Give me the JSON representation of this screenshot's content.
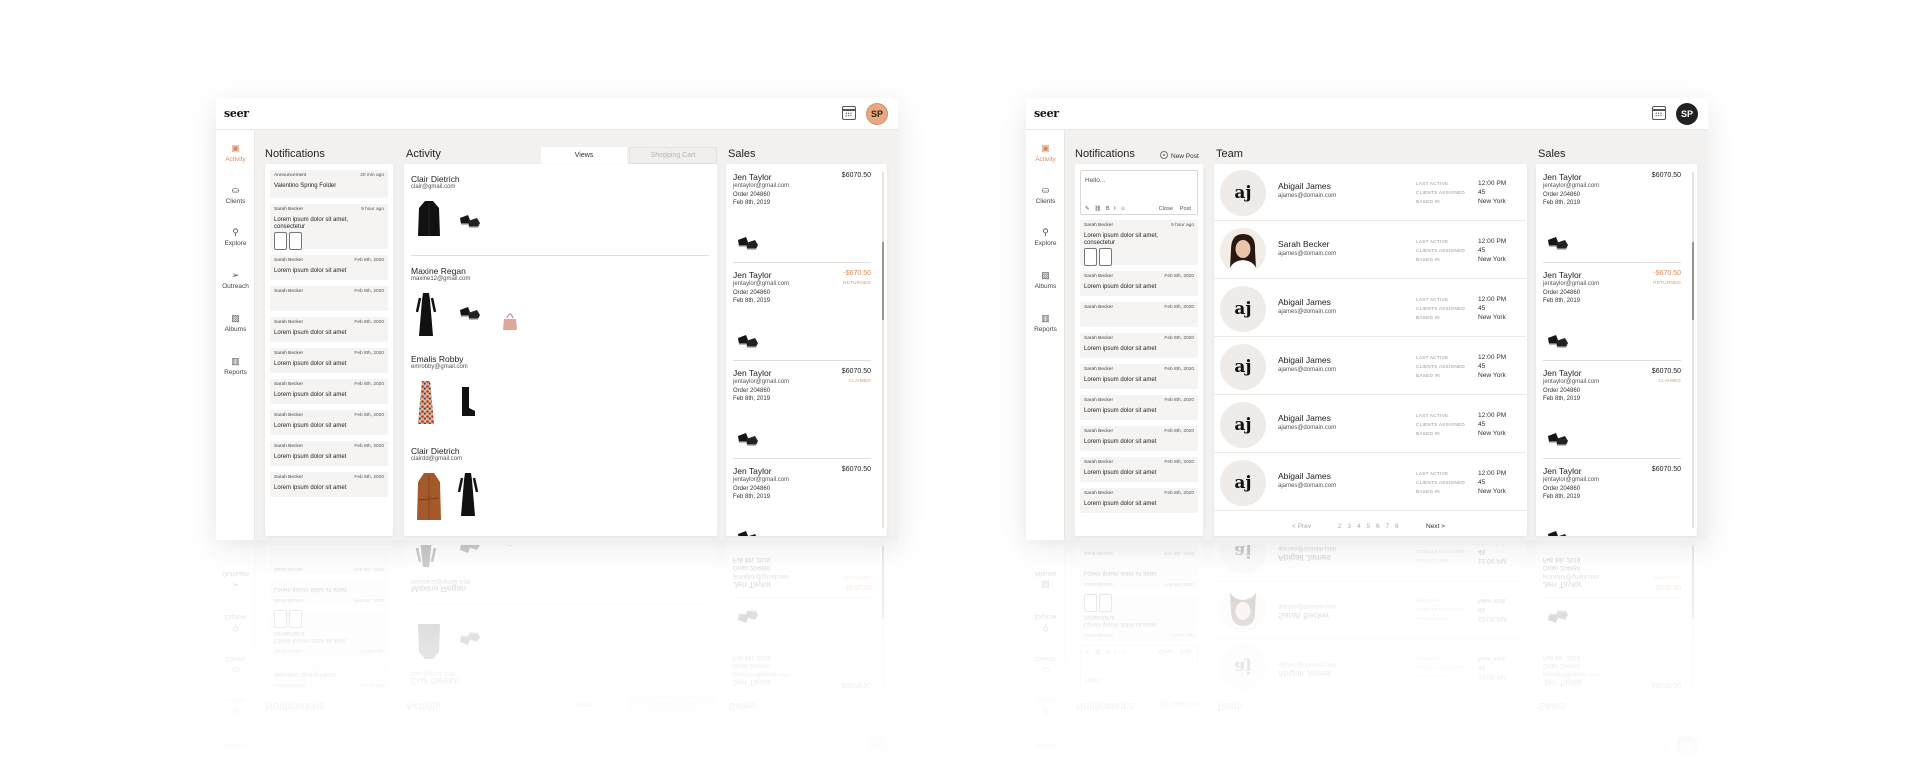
{
  "app": {
    "logo": "seer"
  },
  "nav": [
    {
      "label": "Activity",
      "icon": "activity-icon",
      "glyph": "▣",
      "active": true
    },
    {
      "label": "Clients",
      "icon": "clients-icon",
      "glyph": "⛀",
      "active": false
    },
    {
      "label": "Explore",
      "icon": "explore-icon",
      "glyph": "⚲",
      "active": false
    },
    {
      "label": "Outreach",
      "icon": "outreach-icon",
      "glyph": "➢",
      "active": false
    },
    {
      "label": "Albums",
      "icon": "albums-icon",
      "glyph": "▨",
      "active": false
    },
    {
      "label": "Reports",
      "icon": "reports-icon",
      "glyph": "▥",
      "active": false
    }
  ],
  "nav_right": [
    {
      "label": "Activity",
      "icon": "activity-icon",
      "glyph": "▣",
      "active": true
    },
    {
      "label": "Clients",
      "icon": "clients-icon",
      "glyph": "⛀",
      "active": false
    },
    {
      "label": "Explore",
      "icon": "explore-icon",
      "glyph": "⚲",
      "active": false
    },
    {
      "label": "Albums",
      "icon": "albums-icon",
      "glyph": "▨",
      "active": false
    },
    {
      "label": "Reports",
      "icon": "reports-icon",
      "glyph": "▥",
      "active": false
    }
  ],
  "left": {
    "avatar": "SP",
    "notifications_title": "Notifications",
    "activity_title": "Activity",
    "sales_title": "Sales",
    "tabs": [
      {
        "label": "Views",
        "active": true
      },
      {
        "label": "Shopping Cart",
        "active": false
      }
    ],
    "notifications": [
      {
        "who": "Announcement",
        "when": "20 min ago",
        "msg": "Valentino Spring Folder"
      },
      {
        "who": "Sarah Becker",
        "when": "9 hour ago",
        "msg": "Lorem ipsum dolor sit amet, consectetur",
        "thumbs": [
          "pic1",
          "pic2"
        ]
      },
      {
        "who": "Sarah Becker",
        "when": "Feb 8th, 2020",
        "msg": "Lorem ipsum dolor sit amet"
      },
      {
        "who": "Sarah Becker",
        "when": "Feb 8th, 2020",
        "msg": ""
      },
      {
        "who": "Sarah Becker",
        "when": "Feb 8th, 2020",
        "msg": "Lorem ipsum dolor sit amet"
      },
      {
        "who": "Sarah Becker",
        "when": "Feb 8th, 2020",
        "msg": "Lorem ipsum dolor sit amet"
      },
      {
        "who": "Sarah Becker",
        "when": "Feb 8th, 2020",
        "msg": "Lorem ipsum dolor sit amet"
      },
      {
        "who": "Sarah Becker",
        "when": "Feb 8th, 2020",
        "msg": "Lorem ipsum dolor sit amet"
      },
      {
        "who": "Sarah Becker",
        "when": "Feb 8th, 2020",
        "msg": "Lorem ipsum dolor sit amet"
      },
      {
        "who": "Sarah Becker",
        "when": "Feb 8th, 2020",
        "msg": "Lorem ipsum dolor sit amet"
      }
    ],
    "activity": [
      {
        "name": "Clair Dietrich",
        "email": "clair@gmail.com",
        "items": [
          "black-coat",
          "black-shoes"
        ]
      },
      {
        "name": "Maxine Regan",
        "email": "maxine12@gmail.com",
        "items": [
          "black-dress",
          "black-shoes",
          "pink-bag"
        ]
      },
      {
        "name": "Emalis Robby",
        "email": "emrobby@gmail.com",
        "items": [
          "floral-dress",
          "black-boot"
        ]
      },
      {
        "name": "Clair Dietrich",
        "email": "clairdd@gmail.com",
        "items": [
          "brown-coat",
          "black-dress"
        ]
      }
    ],
    "sales": [
      {
        "name": "Jen Taylor",
        "email": "jentaylor@gmail.com",
        "order": "Order 204860",
        "date": "Feb 8th, 2019",
        "amount": "$6070.50",
        "status": ""
      },
      {
        "name": "Jen Taylor",
        "email": "jentaylor@gmail.com",
        "order": "Order 204860",
        "date": "Feb 8th, 2019",
        "amount": "-$670.50",
        "status": "RETURNED"
      },
      {
        "name": "Jen Taylor",
        "email": "jentaylor@gmail.com",
        "order": "Order 204860",
        "date": "Feb 8th, 2019",
        "amount": "$6070.50",
        "status": "CLAIMED"
      },
      {
        "name": "Jen Taylor",
        "email": "jentaylor@gmail.com",
        "order": "Order 204860",
        "date": "Feb 8th, 2019",
        "amount": "$6070.50",
        "status": ""
      }
    ]
  },
  "right": {
    "avatar": "SP",
    "notifications_title": "Notifications",
    "new_post": "New Post",
    "team_title": "Team",
    "sales_title": "Sales",
    "compose": {
      "placeholder": "Hello...",
      "tools": "✎ ⛓ B I ☺",
      "close": "Close",
      "post": "Post"
    },
    "notifications": [
      {
        "who": "Sarah Becker",
        "when": "9 hour ago",
        "msg": "Lorem ipsum dolor sit amet, consectetur",
        "thumbs": [
          "pic1",
          "pic2"
        ]
      },
      {
        "who": "Sarah Becker",
        "when": "Feb 8th, 2020",
        "msg": "Lorem ipsum dolor sit amet"
      },
      {
        "who": "Sarah Becker",
        "when": "Feb 8th, 2020",
        "msg": ""
      },
      {
        "who": "Sarah Becker",
        "when": "Feb 8th, 2020",
        "msg": "Lorem ipsum dolor sit amet"
      },
      {
        "who": "Sarah Becker",
        "when": "Feb 8th, 2020",
        "msg": "Lorem ipsum dolor sit amet"
      },
      {
        "who": "Sarah Becker",
        "when": "Feb 8th, 2020",
        "msg": "Lorem ipsum dolor sit amet"
      },
      {
        "who": "Sarah Becker",
        "when": "Feb 8th, 2020",
        "msg": "Lorem ipsum dolor sit amet"
      },
      {
        "who": "Sarah Becker",
        "when": "Feb 8th, 2020",
        "msg": "Lorem ipsum dolor sit amet"
      },
      {
        "who": "Sarah Becker",
        "when": "Feb 8th, 2020",
        "msg": "Lorem ipsum dolor sit amet"
      }
    ],
    "team_keys": [
      "LAST ACTIVE",
      "CLIENTS ASSIGNED",
      "BASED IN"
    ],
    "team": [
      {
        "initials": "aj",
        "photo": false,
        "name": "Abigail James",
        "email": "ajames@domain.com",
        "last_active": "12:00 PM",
        "clients": "45",
        "based": "New York"
      },
      {
        "initials": "",
        "photo": true,
        "name": "Sarah Becker",
        "email": "ajames@domain.com",
        "last_active": "12:00 PM",
        "clients": "45",
        "based": "New York"
      },
      {
        "initials": "aj",
        "photo": false,
        "name": "Abigail James",
        "email": "ajames@domain.com",
        "last_active": "12:00 PM",
        "clients": "45",
        "based": "New York"
      },
      {
        "initials": "aj",
        "photo": false,
        "name": "Abigail James",
        "email": "ajames@domain.com",
        "last_active": "12:00 PM",
        "clients": "45",
        "based": "New York"
      },
      {
        "initials": "aj",
        "photo": false,
        "name": "Abigail James",
        "email": "ajames@domain.com",
        "last_active": "12:00 PM",
        "clients": "45",
        "based": "New York"
      },
      {
        "initials": "aj",
        "photo": false,
        "name": "Abigail James",
        "email": "ajames@domain.com",
        "last_active": "12:00 PM",
        "clients": "45",
        "based": "New York"
      }
    ],
    "pager": {
      "prev": "< Prev",
      "pages": [
        "2",
        "3",
        "4",
        "5",
        "6",
        "7",
        "8"
      ],
      "next": "Next >"
    },
    "sales": [
      {
        "name": "Jen Taylor",
        "email": "jentaylor@gmail.com",
        "order": "Order 204860",
        "date": "Feb 8th, 2019",
        "amount": "$6070.50",
        "status": ""
      },
      {
        "name": "Jen Taylor",
        "email": "jentaylor@gmail.com",
        "order": "Order 204860",
        "date": "Feb 8th, 2019",
        "amount": "-$670.50",
        "status": "RETURNED"
      },
      {
        "name": "Jen Taylor",
        "email": "jentaylor@gmail.com",
        "order": "Order 204860",
        "date": "Feb 8th, 2019",
        "amount": "$6070.50",
        "status": "CLAIMED"
      },
      {
        "name": "Jen Taylor",
        "email": "jentaylor@gmail.com",
        "order": "Order 204860",
        "date": "Feb 8th, 2019",
        "amount": "$6070.50",
        "status": ""
      }
    ]
  }
}
